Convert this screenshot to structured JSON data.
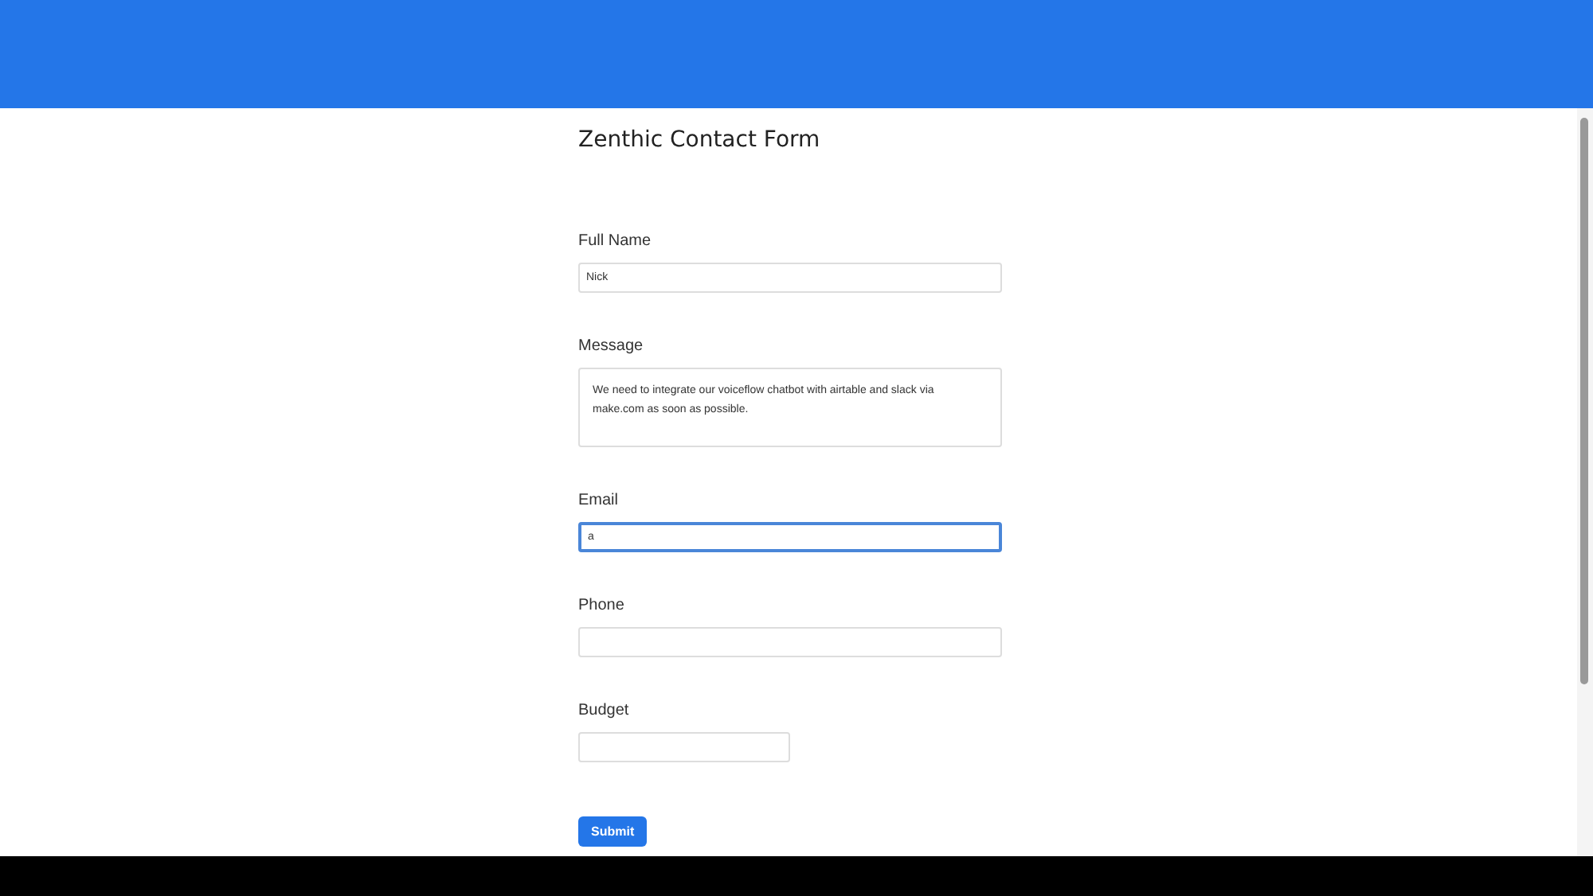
{
  "form": {
    "title": "Zenthic Contact Form",
    "fields": [
      {
        "label": "Full Name",
        "kind": "text",
        "value": "Nick",
        "focused": false
      },
      {
        "label": "Message",
        "kind": "textarea",
        "value": "We need to integrate our voiceflow chatbot with airtable and slack via make.com as soon as possible.",
        "focused": false
      },
      {
        "label": "Email",
        "kind": "text",
        "value": "a",
        "focused": true
      },
      {
        "label": "Phone",
        "kind": "text",
        "focused": false
      },
      {
        "label": "Budget",
        "kind": "number",
        "focused": false
      }
    ],
    "submit": "Submit"
  }
}
